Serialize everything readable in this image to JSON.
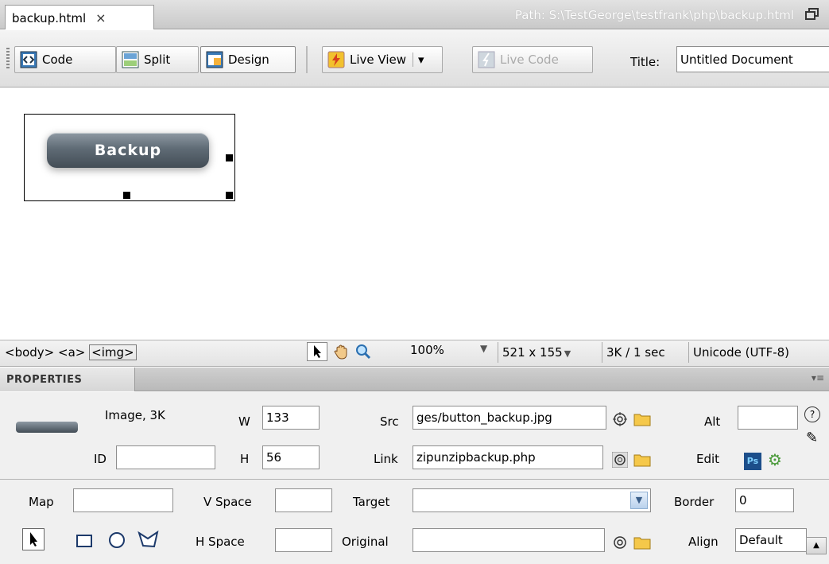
{
  "tab": {
    "filename": "backup.html",
    "close": "×"
  },
  "path": {
    "text": "Path:  S:\\TestGeorge\\testfrank\\php\\backup.html"
  },
  "toolbar": {
    "code": "Code",
    "split": "Split",
    "design": "Design",
    "live_view": "Live View",
    "live_code": "Live Code",
    "title_label": "Title:",
    "title_value": "Untitled Document"
  },
  "canvas": {
    "button_text": "Backup"
  },
  "statusbar": {
    "tag_body": "<body>",
    "tag_a": "<a>",
    "tag_img": "<img>",
    "zoom": "100%",
    "dimensions": "521 x 155",
    "size_time": "3K / 1 sec",
    "encoding": "Unicode (UTF-8)"
  },
  "properties": {
    "header": "PROPERTIES",
    "type": "Image, 3K",
    "id_label": "ID",
    "id_value": "",
    "w_label": "W",
    "w_value": "133",
    "h_label": "H",
    "h_value": "56",
    "src_label": "Src",
    "src_value": "ges/button_backup.jpg",
    "link_label": "Link",
    "link_value": "zipunzipbackup.php",
    "alt_label": "Alt",
    "alt_value": "",
    "edit_label": "Edit",
    "map_label": "Map",
    "map_value": "",
    "vspace_label": "V Space",
    "hspace_label": "H Space",
    "target_label": "Target",
    "original_label": "Original",
    "border_label": "Border",
    "border_value": "0",
    "align_label": "Align",
    "align_value": "Default",
    "ps_badge": "Ps"
  }
}
